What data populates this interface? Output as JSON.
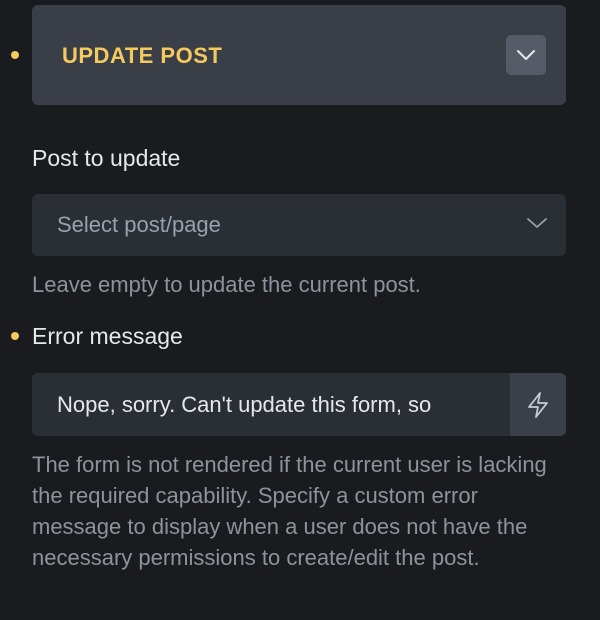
{
  "update_post": {
    "title": "UPDATE POST",
    "toggle_icon": "chevron-down-icon"
  },
  "post_to_update": {
    "label": "Post to update",
    "placeholder": "Select post/page",
    "help": "Leave empty to update the current post."
  },
  "error_message": {
    "label": "Error message",
    "value": "Nope, sorry. Can't update this form, so",
    "action_icon": "lightning-icon",
    "help": "The form is not rendered if the current user is lacking the required capability. Specify a custom error message to display when a user does not have the necessary permissions to create/edit the post."
  },
  "colors": {
    "background": "#1a1b1f",
    "panel": "#393e47",
    "accent": "#f4c95d",
    "field": "#2a2e35",
    "muted_text": "#8d939c"
  }
}
